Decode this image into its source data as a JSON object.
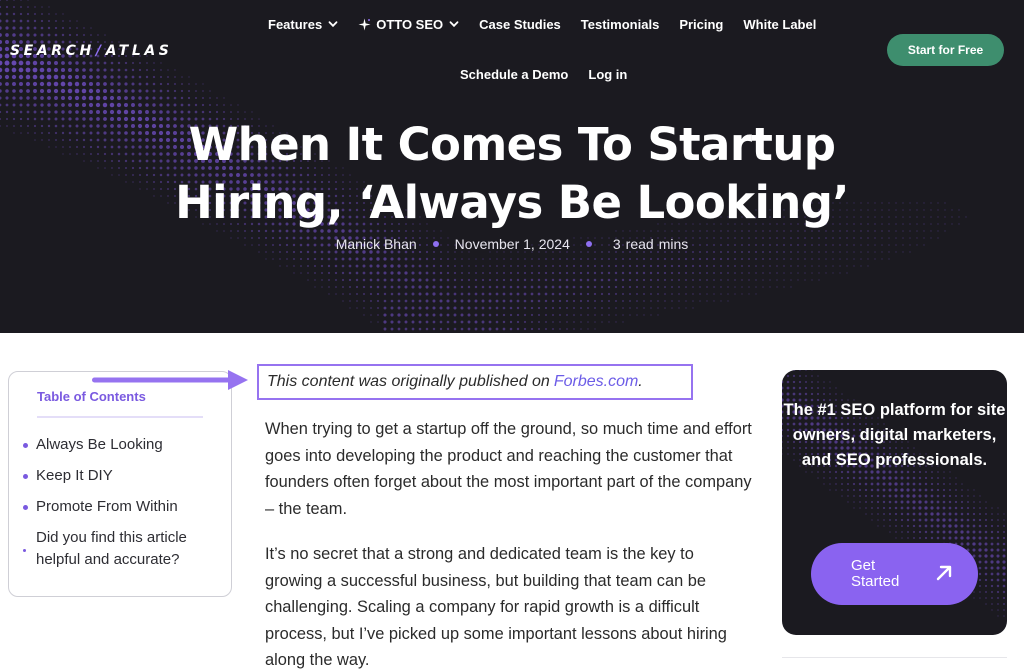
{
  "brand": {
    "logo_left": "SEARCH",
    "logo_slash": "/",
    "logo_right": "ATLAS"
  },
  "nav": {
    "features": "Features",
    "otto_seo": "OTTO SEO",
    "case_studies": "Case Studies",
    "testimonials": "Testimonials",
    "pricing": "Pricing",
    "white_label": "White Label",
    "schedule_demo": "Schedule a Demo",
    "login": "Log in",
    "start_free": "Start for Free"
  },
  "article": {
    "title_line1": "When It Comes To Startup",
    "title_line2": "Hiring, ‘Always Be Looking’",
    "author": "Manick Bhan",
    "date": "November 1, 2024",
    "read_num": "3",
    "read_word": "read",
    "read_unit": "mins",
    "orig_prefix": "This content was originally published on",
    "orig_link": "Forbes.com",
    "orig_suffix": ".",
    "paragraph1": "When trying to get a startup off the ground, so much time and effort goes into developing the product and reaching the customer that founders often forget about the most important part of the company – the team.",
    "paragraph2": "It’s no secret that a strong and dedicated team is the key to growing a successful business, but building that team can be challenging. Scaling a company for rapid growth is a difficult process, but I’ve picked up some important lessons about hiring along the way."
  },
  "toc": {
    "title": "Table of Contents",
    "items": [
      {
        "label": "Always Be Looking"
      },
      {
        "label": "Keep It DIY"
      },
      {
        "label": "Promote From Within"
      },
      {
        "label": "Did you find this article helpful and accurate?"
      }
    ]
  },
  "promo": {
    "heading": "The #1 SEO platform for site owners, digital marketers, and SEO professionals.",
    "button": "Get Started"
  },
  "colors": {
    "hero_bg": "#1b1a20",
    "accent_purple": "#8a63f0",
    "cta_green": "#3e8e6e",
    "link": "#6c5ce7"
  },
  "icons": [
    "chevron-down-icon",
    "sparkle-icon",
    "arrow-right-icon",
    "arrow-up-right-icon"
  ]
}
